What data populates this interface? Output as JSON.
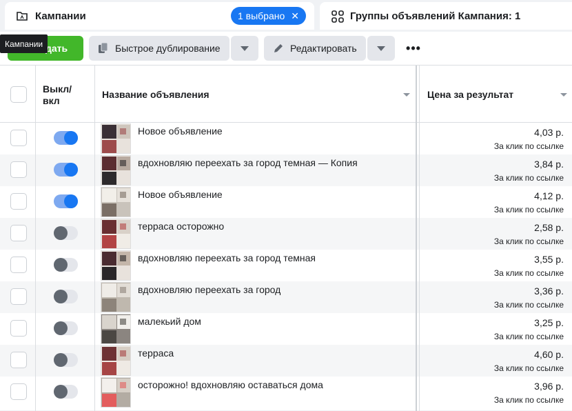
{
  "tabs": {
    "campaigns_label": "Кампании",
    "selected_pill": "1 выбрано",
    "adsets_label": "Группы объявлений Кампания: 1"
  },
  "toolbar": {
    "create_label": "здать",
    "duplicate_label": "Быстрое дублирование",
    "edit_label": "Редактировать",
    "more_label": "•••",
    "tooltip": "Кампании"
  },
  "table": {
    "col_toggle": "Выкл/\nвкл",
    "col_toggle_line1": "Выкл/",
    "col_toggle_line2": "вкл",
    "col_name": "Название объявления",
    "col_price": "Цена за результат"
  },
  "rows": [
    {
      "name": "Новое объявление",
      "price": "4,03 р.",
      "unit": "За клик по ссылке",
      "on": true
    },
    {
      "name": "вдохновляю переехать за город темная — Копия",
      "price": "3,84 р.",
      "unit": "За клик по ссылке",
      "on": true
    },
    {
      "name": "Новое объявление",
      "price": "4,12 р.",
      "unit": "За клик по ссылке",
      "on": true
    },
    {
      "name": "терраса осторожно",
      "price": "2,58 р.",
      "unit": "За клик по ссылке",
      "on": false
    },
    {
      "name": "вдохновляю переехать за город темная",
      "price": "3,55 р.",
      "unit": "За клик по ссылке",
      "on": false
    },
    {
      "name": "вдохновляю переехать за город",
      "price": "3,36 р.",
      "unit": "За клик по ссылке",
      "on": false
    },
    {
      "name": "малекьий дом",
      "price": "3,25 р.",
      "unit": "За клик по ссылке",
      "on": false
    },
    {
      "name": "терраса",
      "price": "4,60 р.",
      "unit": "За клик по ссылке",
      "on": false
    },
    {
      "name": "осторожно! вдохновляю оставаться дома",
      "price": "3,96 р.",
      "unit": "За клик по ссылке",
      "on": false
    }
  ],
  "colors": {
    "accent": "#1877f2",
    "create_green": "#42b72a",
    "toggle_on_track": "#7ea9f0",
    "toggle_off_knob": "#606770"
  }
}
